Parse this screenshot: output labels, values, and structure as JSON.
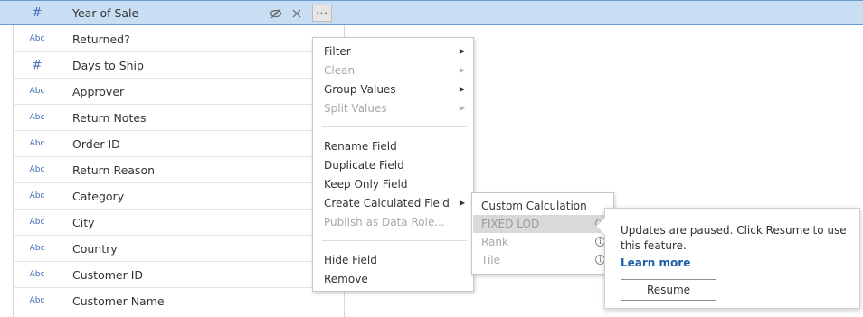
{
  "header": {
    "type_symbol": "#",
    "name": "Year of Sale",
    "hide_icon": "eye-slash-icon",
    "close_icon": "close-icon",
    "more_label": "···"
  },
  "fields": [
    {
      "type": "Abc",
      "name": "Returned?"
    },
    {
      "type": "#",
      "name": "Days to Ship"
    },
    {
      "type": "Abc",
      "name": "Approver"
    },
    {
      "type": "Abc",
      "name": "Return Notes"
    },
    {
      "type": "Abc",
      "name": "Order ID"
    },
    {
      "type": "Abc",
      "name": "Return Reason"
    },
    {
      "type": "Abc",
      "name": "Category"
    },
    {
      "type": "Abc",
      "name": "City"
    },
    {
      "type": "Abc",
      "name": "Country"
    },
    {
      "type": "Abc",
      "name": "Customer ID"
    },
    {
      "type": "Abc",
      "name": "Customer Name"
    }
  ],
  "menu": {
    "filter": "Filter",
    "clean": "Clean",
    "group_values": "Group Values",
    "split_values": "Split Values",
    "rename": "Rename Field",
    "duplicate": "Duplicate Field",
    "keep_only": "Keep Only Field",
    "create_calc": "Create Calculated Field",
    "publish_role": "Publish as Data Role...",
    "hide": "Hide Field",
    "remove": "Remove",
    "arrow": "▶"
  },
  "submenu": {
    "custom_calc": "Custom Calculation",
    "fixed_lod": "FIXED LOD",
    "rank": "Rank",
    "tile": "Tile",
    "info_glyph": "i"
  },
  "tooltip": {
    "message": "Updates are paused. Click Resume to use this feature.",
    "link": "Learn more",
    "button": "Resume"
  }
}
